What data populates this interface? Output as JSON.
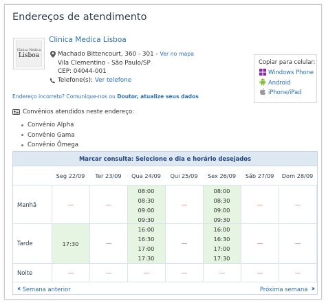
{
  "page": {
    "title": "Endereços de atendimento"
  },
  "clinic": {
    "name": "Clinica Medica Lisboa",
    "logo_top": "Clinica Medica",
    "logo_main": "Lisboa",
    "address_line1": "Machado Bittencourt, 360 - 301 -",
    "map_link": "Ver no mapa",
    "address_line2": "Vila Clementino - São Paulo/SP",
    "cep": "CEP: 04044-001",
    "phone_label": "Telefone(s):",
    "phone_link": "Ver telefone"
  },
  "copy_box": {
    "title": "Copiar para celular:",
    "items": [
      {
        "label": "Windows Phone",
        "icon": "windows-icon",
        "color": "#8a2c9b"
      },
      {
        "label": "Android",
        "icon": "android-icon",
        "color": "#8cbd3f"
      },
      {
        "label": "iPhone/iPad",
        "icon": "apple-icon",
        "color": "#999999"
      }
    ]
  },
  "report": {
    "text": "Endereço incorreto? Comunique-nos ou",
    "link": "Doutor, atualize seus dados"
  },
  "convenios": {
    "heading": "Convênios atendidos neste endereço:",
    "items": [
      "Convênio Alpha",
      "Convênio Gama",
      "Convênio Ômega"
    ]
  },
  "schedule": {
    "header": "Marcar consulta: Selecione o dia e horário desejados",
    "days": [
      "Seg 22/09",
      "Ter 23/09",
      "Qua 24/09",
      "Qui 25/09",
      "Sex 26/09",
      "Sáb 27/09",
      "Dom 28/09"
    ],
    "periods": [
      "Manhã",
      "Tarde",
      "Noite"
    ],
    "slots": {
      "Manhã": [
        [],
        [],
        [
          "08:00",
          "08:30",
          "09:00",
          "09:30"
        ],
        [],
        [
          "08:00",
          "08:30",
          "09:00",
          "09:30"
        ],
        [],
        []
      ],
      "Tarde": [
        [
          "17:30"
        ],
        [],
        [
          "16:00",
          "16:30",
          "17:00",
          "17:30"
        ],
        [],
        [
          "16:00",
          "16:30",
          "17:00",
          "17:30"
        ],
        [],
        []
      ],
      "Noite": [
        [],
        [],
        [],
        [],
        [],
        [],
        []
      ]
    },
    "prev_label": "Semana anterior",
    "next_label": "Próxima semana",
    "colors": {
      "available": "#e6f4e2",
      "header_bg": "#dde8f3",
      "dash": "#e5a3a3"
    }
  }
}
